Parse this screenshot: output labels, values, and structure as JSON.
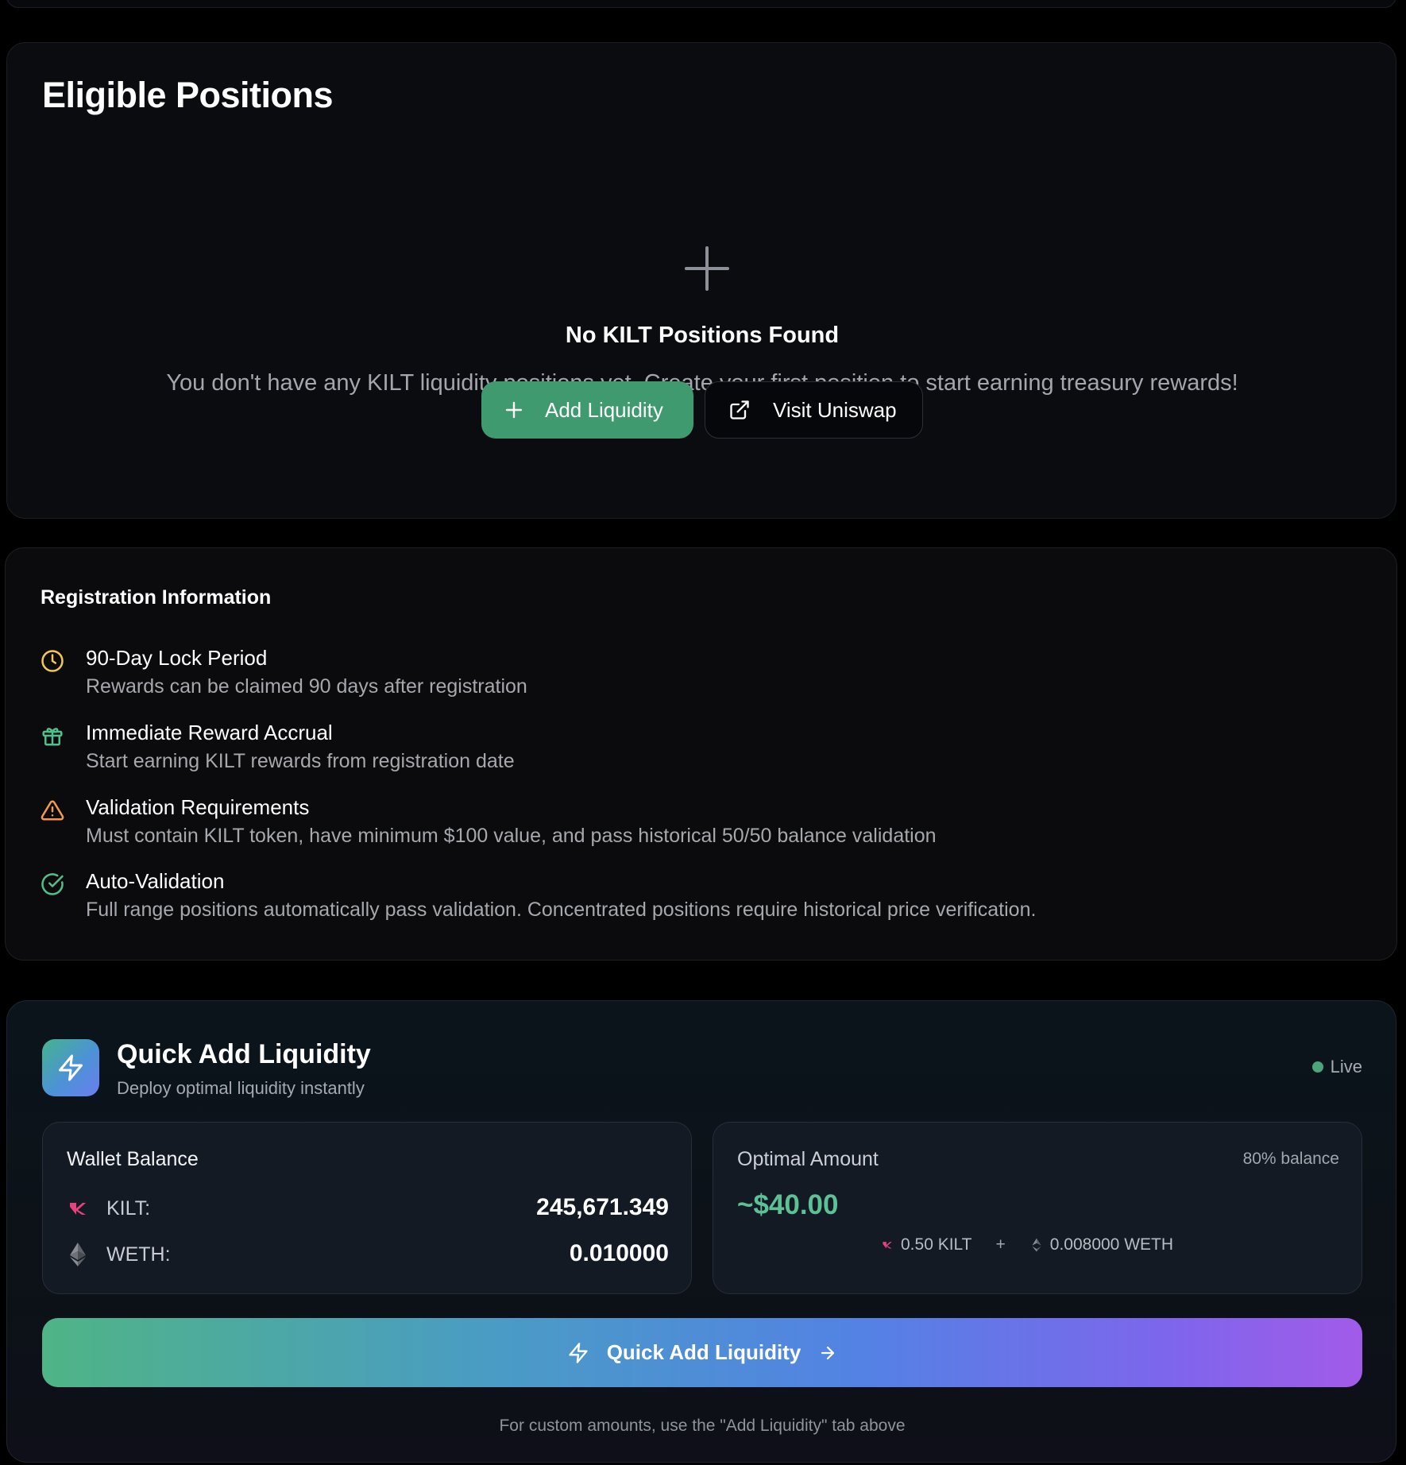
{
  "eligible": {
    "title": "Eligible Positions",
    "empty_icon": "plus-icon",
    "empty_title": "No KILT Positions Found",
    "empty_description": "You don't have any KILT liquidity positions yet. Create your first position to start earning treasury rewards!",
    "add_button_label": "Add Liquidity",
    "add_button_icon": "plus-icon",
    "visit_button_label": "Visit Uniswap",
    "visit_button_icon": "external-link-icon",
    "accent_color": "#3f9a6f"
  },
  "registration": {
    "title": "Registration Information",
    "items": [
      {
        "icon": "clock-icon",
        "color": "#f2c94c",
        "title": "90-Day Lock Period",
        "description": "Rewards can be claimed 90 days after registration"
      },
      {
        "icon": "gift-icon",
        "color": "#4fbf8b",
        "title": "Immediate Reward Accrual",
        "description": "Start earning KILT rewards from registration date"
      },
      {
        "icon": "warning-icon",
        "color": "#f2994a",
        "title": "Validation Requirements",
        "description": "Must contain KILT token, have minimum $100 value, and pass historical 50/50 balance validation"
      },
      {
        "icon": "check-circle-icon",
        "color": "#4fbf8b",
        "title": "Auto-Validation",
        "description": "Full range positions automatically pass validation. Concentrated positions require historical price verification."
      }
    ]
  },
  "quick_add": {
    "icon": "lightning-icon",
    "title": "Quick Add Liquidity",
    "subtitle": "Deploy optimal liquidity instantly",
    "status": "Live",
    "status_color": "#4aa57b",
    "wallet": {
      "heading": "Wallet Balance",
      "rows": [
        {
          "icon": "kilt-icon",
          "label": "KILT:",
          "value": "245,671.349"
        },
        {
          "icon": "ethereum-icon",
          "label": "WETH:",
          "value": "0.010000"
        }
      ]
    },
    "optimal": {
      "heading": "Optimal Amount",
      "note": "80% balance",
      "value": "~$40.00",
      "kilt_amount": "0.50 KILT",
      "plus": "+",
      "weth_amount": "0.008000 WETH"
    },
    "button_label": "Quick Add Liquidity",
    "button_icon": "lightning-icon",
    "button_arrow": "arrow-right-icon",
    "footer": "For custom amounts, use the \"Add Liquidity\" tab above"
  }
}
